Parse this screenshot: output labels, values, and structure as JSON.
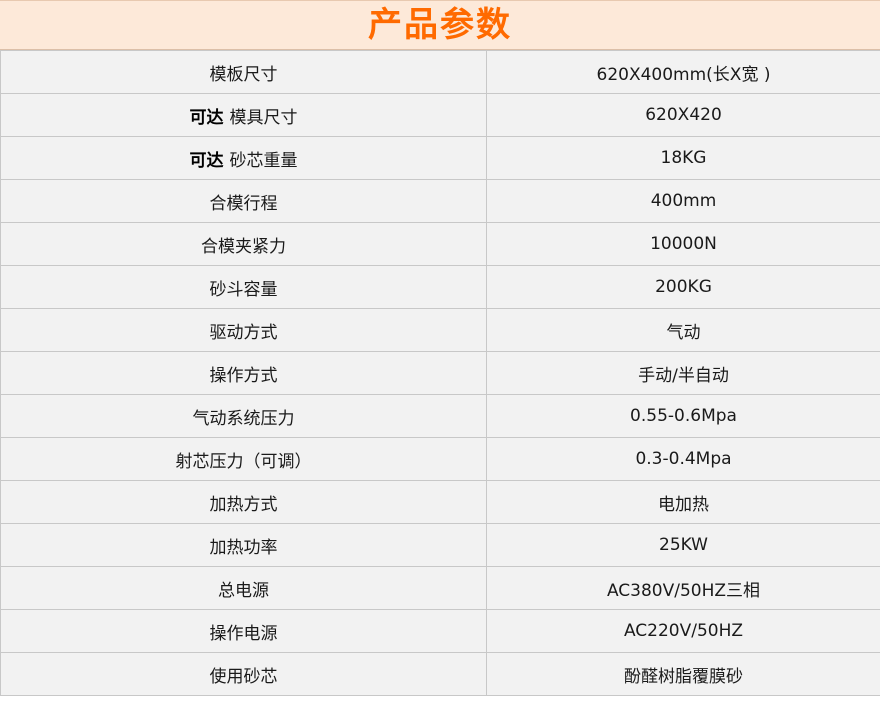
{
  "header": {
    "title": "产品参数"
  },
  "rows": [
    {
      "prefix": "",
      "label": "模板尺寸",
      "value": "620X400mm(长X宽 )"
    },
    {
      "prefix": "可达",
      "label": "模具尺寸",
      "value": "620X420"
    },
    {
      "prefix": "可达",
      "label": "砂芯重量",
      "value": "18KG"
    },
    {
      "prefix": "",
      "label": "合模行程",
      "value": "400mm"
    },
    {
      "prefix": "",
      "label": "合模夹紧力",
      "value": "10000N"
    },
    {
      "prefix": "",
      "label": "砂斗容量",
      "value": "200KG"
    },
    {
      "prefix": "",
      "label": "驱动方式",
      "value": "气动"
    },
    {
      "prefix": "",
      "label": "操作方式",
      "value": "手动/半自动"
    },
    {
      "prefix": "",
      "label": "气动系统压力",
      "value": "0.55-0.6Mpa"
    },
    {
      "prefix": "",
      "label": "射芯压力（可调）",
      "value": "0.3-0.4Mpa"
    },
    {
      "prefix": "",
      "label": "加热方式",
      "value": "电加热"
    },
    {
      "prefix": "",
      "label": "加热功率",
      "value": "25KW"
    },
    {
      "prefix": "",
      "label": "总电源",
      "value": "AC380V/50HZ三相"
    },
    {
      "prefix": "",
      "label": "操作电源",
      "value": "AC220V/50HZ"
    },
    {
      "prefix": "",
      "label": "使用砂芯",
      "value": "酚醛树脂覆膜砂"
    }
  ]
}
